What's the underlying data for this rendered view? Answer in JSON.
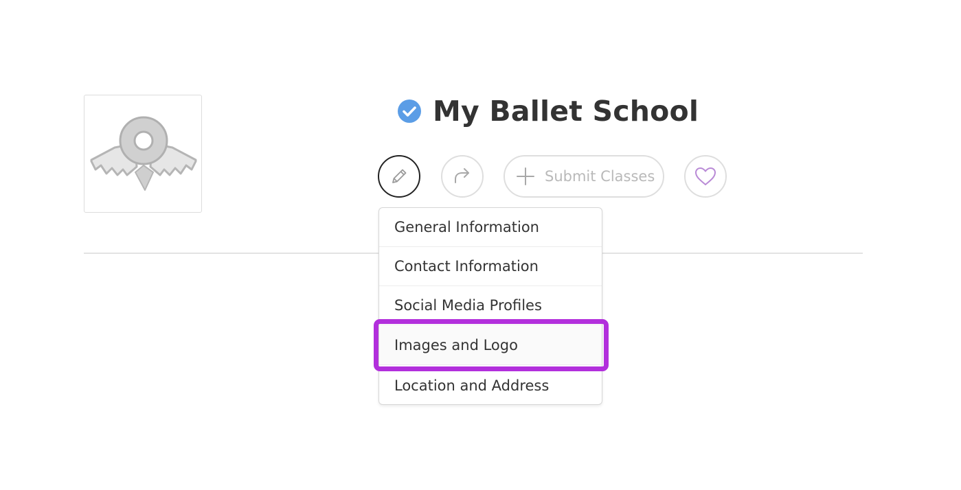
{
  "school": {
    "name": "My Ballet School",
    "verified_icon": "verified-check-icon",
    "logo_icon": "ballet-placeholder-logo"
  },
  "actions": {
    "edit_icon": "pencil-icon",
    "share_icon": "share-arrow-icon",
    "submit_label": "Submit Classes",
    "submit_icon": "plus-icon",
    "favorite_icon": "heart-icon"
  },
  "edit_menu": {
    "items": [
      {
        "label": "General Information"
      },
      {
        "label": "Contact Information"
      },
      {
        "label": "Social Media Profiles"
      },
      {
        "label": "Images and Logo"
      },
      {
        "label": "Location and Address"
      }
    ],
    "highlighted_index": 3
  },
  "colors": {
    "verified_blue": "#5b9de6",
    "highlight_purple": "#b22fdc",
    "heart_purple": "#b98ad6",
    "muted_gray": "#b9b9b9"
  }
}
